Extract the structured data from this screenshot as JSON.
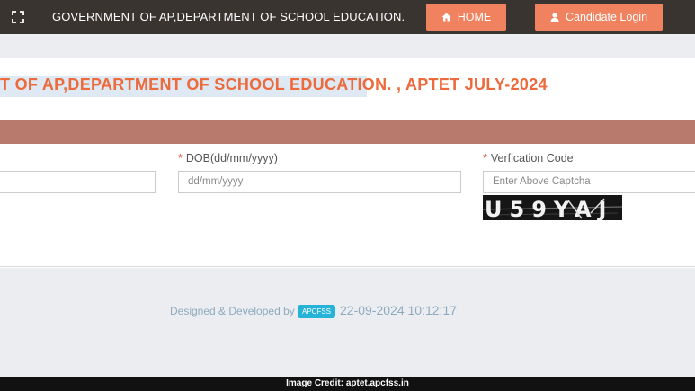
{
  "header": {
    "title": "GOVERNMENT OF AP,DEPARTMENT OF SCHOOL EDUCATION.",
    "home_label": "HOME",
    "login_label": "Candidate Login",
    "fullscreen_icon": "expand-icon",
    "home_icon": "home-icon",
    "login_icon": "user-icon"
  },
  "main": {
    "exam_title": "T OF AP,DEPARTMENT OF SCHOOL EDUCATION. , APTET JULY-2024",
    "form": {
      "required_marker": "*",
      "dob_label": "DOB(dd/mm/yyyy)",
      "dob_placeholder": "dd/mm/yyyy",
      "captcha_label": "Verfication Code",
      "captcha_placeholder": "Enter Above Captcha",
      "captcha_text": "U59YAJ"
    }
  },
  "footer": {
    "designed_by": "Designed & Developed by",
    "badge": "APCFSS",
    "timestamp": "22-09-2024 10:12:17"
  },
  "credit": {
    "text": "Image Credit: aptet.apcfss.in"
  },
  "colors": {
    "header_bg": "#3a3431",
    "accent_orange": "#f0825f",
    "title_orange": "#ec6a3b",
    "form_bar": "#b87a6d",
    "badge_blue": "#27b3d8"
  }
}
